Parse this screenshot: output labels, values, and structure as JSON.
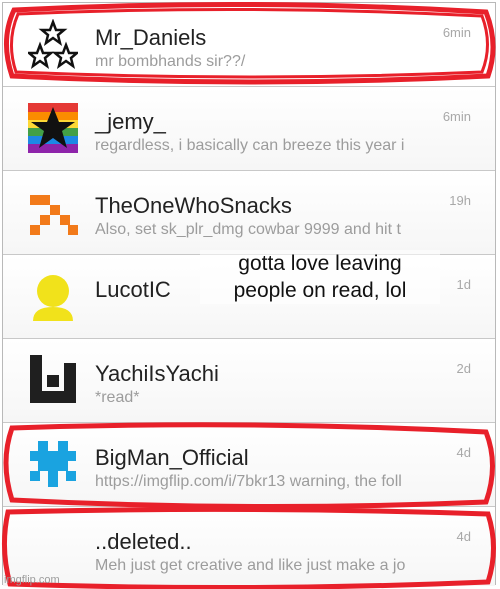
{
  "conversations": [
    {
      "username": "Mr_Daniels",
      "message": "mr bombhands sir??/",
      "time": "6min",
      "avatar": "triple-star-icon"
    },
    {
      "username": "_jemy_",
      "message": "regardless, i basically can breeze this year i",
      "time": "6min",
      "avatar": "rainbow-star-icon"
    },
    {
      "username": "TheOneWhoSnacks",
      "message": "Also, set sk_plr_dmg cowbar 9999 and hit t",
      "time": "19h",
      "avatar": "orange-pixel-icon"
    },
    {
      "username": "LucotIC",
      "message": "",
      "time": "1d",
      "avatar": "yellow-person-icon"
    },
    {
      "username": "YachiIsYachi",
      "message": "*read*",
      "time": "2d",
      "avatar": "black-pixel-icon"
    },
    {
      "username": "BigMan_Official",
      "message": "https://imgflip.com/i/7bkr13 warning, the foll",
      "time": "4d",
      "avatar": "blue-invader-icon"
    },
    {
      "username": "..deleted..",
      "message": "Meh just get creative and like just make a jo",
      "time": "4d",
      "avatar": ""
    }
  ],
  "overlay": {
    "line1": "gotta love leaving",
    "line2": "people on read, lol"
  },
  "watermark": "imgflip.com",
  "colors": {
    "scribble": "#e8202a",
    "rainbow": [
      "#e53935",
      "#fb8c00",
      "#fdd835",
      "#43a047",
      "#1e88e5",
      "#8e24aa"
    ],
    "orange": "#f27a1a",
    "yellow": "#f1e21b",
    "blue": "#1aa3e0"
  }
}
